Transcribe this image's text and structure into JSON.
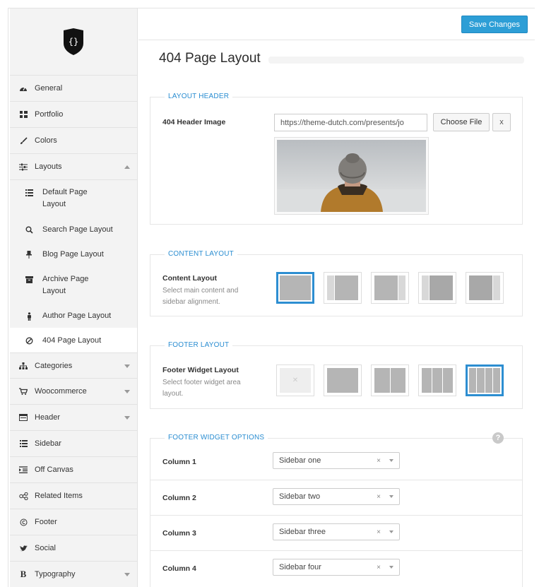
{
  "toolbar": {
    "save_label": "Save Changes"
  },
  "page": {
    "title": "404 Page Layout"
  },
  "sidebar": {
    "items_top": [
      {
        "label": "General",
        "icon": "dashboard-icon"
      },
      {
        "label": "Portfolio",
        "icon": "grid-icon"
      },
      {
        "label": "Colors",
        "icon": "brush-icon"
      },
      {
        "label": "Layouts",
        "icon": "sliders-icon"
      }
    ],
    "sub_items": [
      {
        "label": "Default Page Layout",
        "icon": "list-icon"
      },
      {
        "label": "Search Page Layout",
        "icon": "search-icon"
      },
      {
        "label": "Blog Page Layout",
        "icon": "pin-icon"
      },
      {
        "label": "Archive Page Layout",
        "icon": "archive-icon"
      },
      {
        "label": "Author Page Layout",
        "icon": "person-icon"
      },
      {
        "label": "404 Page Layout",
        "icon": "ban-icon"
      }
    ],
    "items_bottom": [
      {
        "label": "Categories",
        "icon": "sitemap-icon"
      },
      {
        "label": "Woocommerce",
        "icon": "cart-icon"
      },
      {
        "label": "Header",
        "icon": "window-icon"
      },
      {
        "label": "Sidebar",
        "icon": "list-icon"
      },
      {
        "label": "Off Canvas",
        "icon": "indent-icon"
      },
      {
        "label": "Related Items",
        "icon": "share-icon"
      },
      {
        "label": "Footer",
        "icon": "copyright-icon"
      },
      {
        "label": "Social",
        "icon": "twitter-icon"
      },
      {
        "label": "Typography",
        "icon": "bold-icon"
      }
    ]
  },
  "layout_header": {
    "title": "LAYOUT HEADER",
    "label": "404 Header Image",
    "url": "https://theme-dutch.com/presents/jo",
    "choose_file": "Choose File",
    "clear": "x"
  },
  "content_layout": {
    "title": "CONTENT LAYOUT",
    "label": "Content Layout",
    "desc": "Select main content and sidebar alignment.",
    "selected_index": 0
  },
  "footer_layout": {
    "title": "FOOTER LAYOUT",
    "label": "Footer Widget Layout",
    "desc": "Select footer widget area layout.",
    "selected_index": 4
  },
  "footer_widget_options": {
    "title": "FOOTER WIDGET OPTIONS",
    "help": "?",
    "rows": [
      {
        "label": "Column 1",
        "value": "Sidebar one"
      },
      {
        "label": "Column 2",
        "value": "Sidebar two"
      },
      {
        "label": "Column 3",
        "value": "Sidebar three"
      },
      {
        "label": "Column 4",
        "value": "Sidebar four"
      }
    ],
    "clear": "×"
  }
}
